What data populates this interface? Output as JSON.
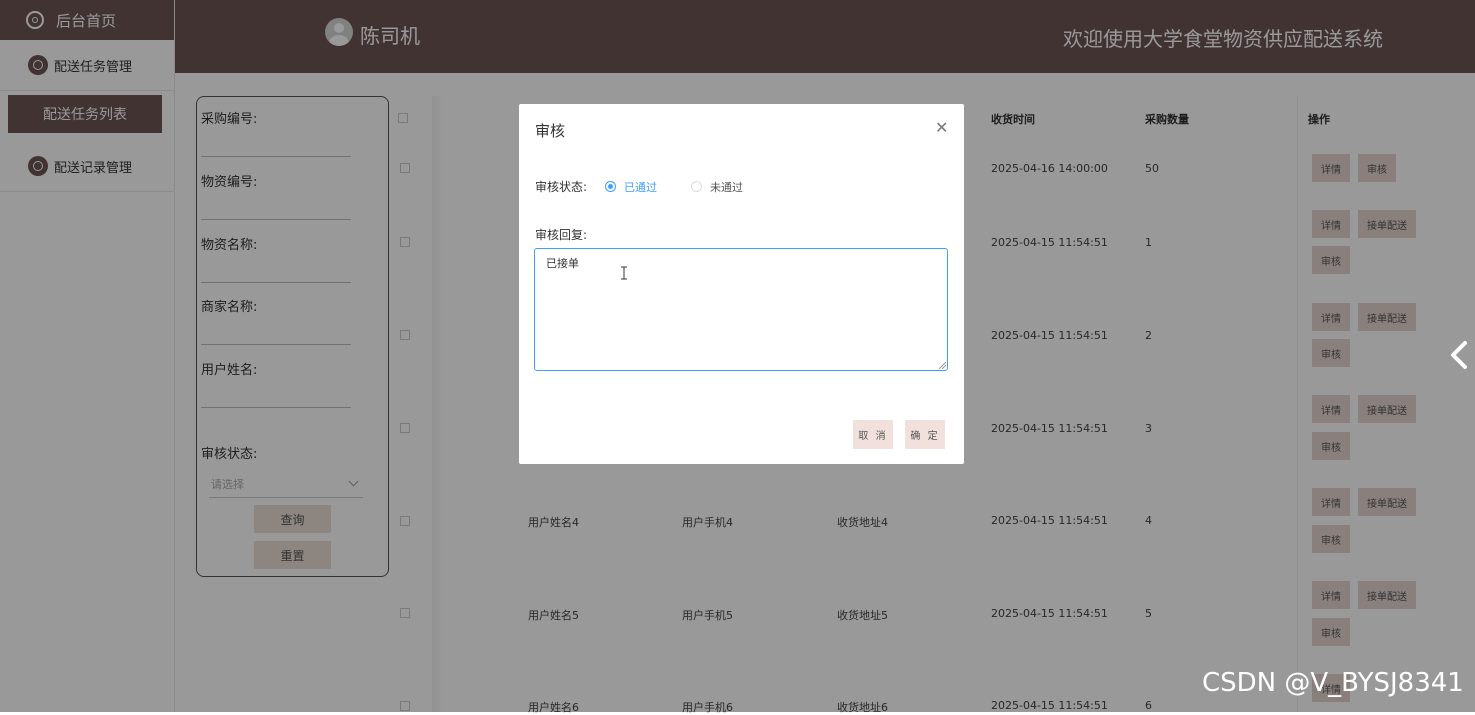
{
  "sidebar": {
    "home": "后台首页",
    "menu1": "配送任务管理",
    "submenu1": "配送任务列表",
    "menu2": "配送记录管理"
  },
  "header": {
    "username": "陈司机",
    "system_name": "欢迎使用大学食堂物资供应配送系统"
  },
  "search": {
    "fields": [
      "采购编号:",
      "物资编号:",
      "物资名称:",
      "商家名称:",
      "用户姓名:"
    ],
    "status_label": "审核状态:",
    "status_placeholder": "请选择",
    "query_button": "查询",
    "reset_button": "重置"
  },
  "table": {
    "headers": {
      "receive_time": "收货时间",
      "quantity": "采购数量",
      "actions": "操作"
    },
    "rows": [
      {
        "name": "",
        "phone": "",
        "address": "",
        "time": "2025-04-16 14:00:00",
        "qty": "50"
      },
      {
        "name": "",
        "phone": "",
        "address": "",
        "time": "2025-04-15 11:54:51",
        "qty": "1"
      },
      {
        "name": "",
        "phone": "",
        "address": "",
        "time": "2025-04-15 11:54:51",
        "qty": "2"
      },
      {
        "name": "",
        "phone": "",
        "address": "",
        "time": "2025-04-15 11:54:51",
        "qty": "3"
      },
      {
        "name": "用户姓名4",
        "phone": "用户手机4",
        "address": "收货地址4",
        "time": "2025-04-15 11:54:51",
        "qty": "4"
      },
      {
        "name": "用户姓名5",
        "phone": "用户手机5",
        "address": "收货地址5",
        "time": "2025-04-15 11:54:51",
        "qty": "5"
      },
      {
        "name": "用户姓名6",
        "phone": "用户手机6",
        "address": "收货地址6",
        "time": "2025-04-15 11:54:51",
        "qty": "6"
      }
    ],
    "actions": {
      "detail": "详情",
      "accept": "接单配送",
      "review": "审核"
    }
  },
  "dialog": {
    "title": "审核",
    "status_label": "审核状态:",
    "option_pass": "已通过",
    "option_fail": "未通过",
    "reply_label": "审核回复:",
    "reply_value": "已接单",
    "cancel": "取 消",
    "confirm": "确 定"
  },
  "watermark": "CSDN @V_BYSJ8341",
  "colors": {
    "brand": "#6e5656",
    "primary": "#409eff",
    "button": "#eaded6"
  }
}
